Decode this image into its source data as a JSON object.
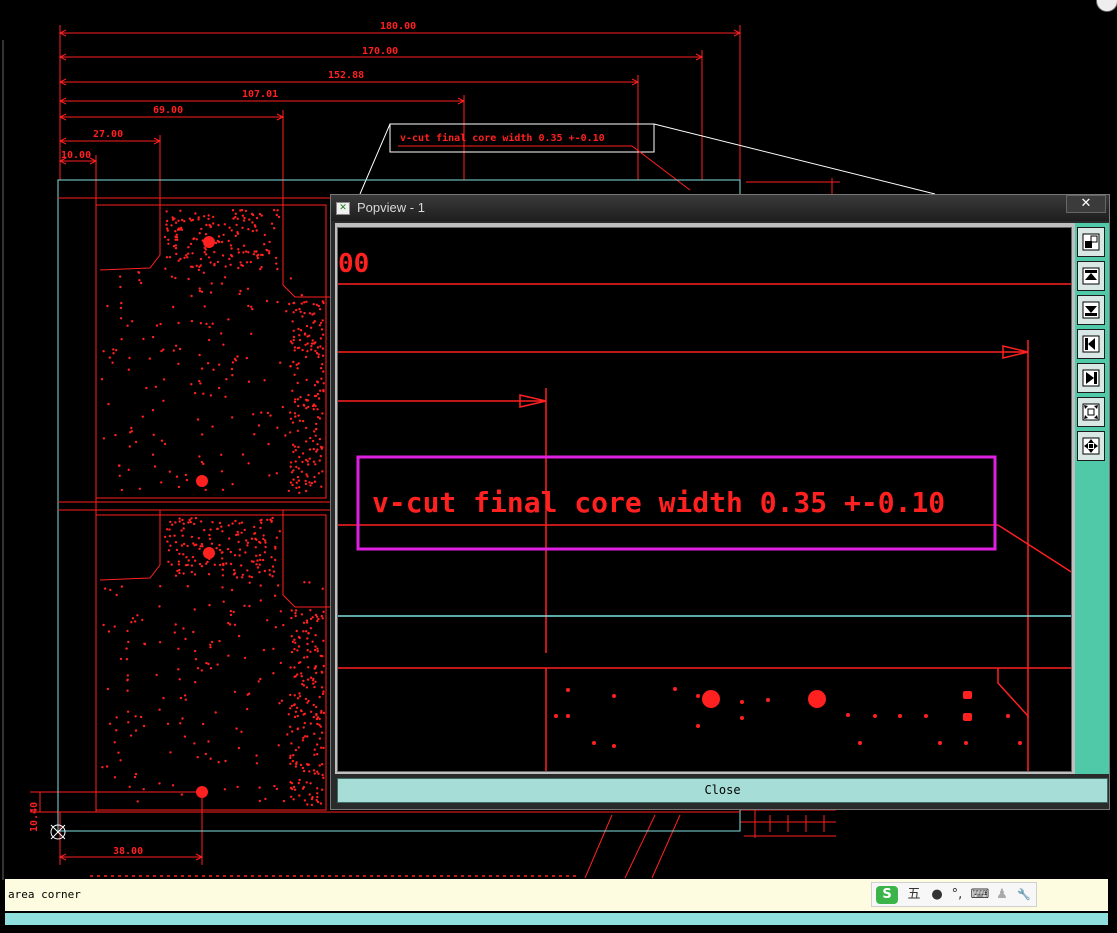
{
  "drawing": {
    "dimensions": [
      "180.00",
      "170.00",
      "152.88",
      "107.01",
      "69.00",
      "27.00",
      "10.00",
      "38.00",
      "10.40"
    ],
    "callout_text": "v-cut final core width 0.35 +-0.10"
  },
  "popview": {
    "title": "Popview - 1",
    "close_x": "✕",
    "zoom_text": "v-cut final core width 0.35 +-0.10",
    "partial_label": "00",
    "close_label": "Close",
    "toolbar": [
      "zoom-window-icon",
      "move-up-icon",
      "move-down-icon",
      "move-left-icon",
      "move-right-icon",
      "zoom-out-icon",
      "fit-view-icon"
    ]
  },
  "status": {
    "text": "area corner",
    "ime": [
      "S",
      "五",
      "●",
      "°,",
      "⌨",
      "♟",
      "🔧"
    ]
  },
  "colors": {
    "drawing_red": "#ff2020",
    "outline_cyan": "#7fe0e0",
    "highlight_magenta": "#e020e0",
    "toolbar_green": "#4fc9a8"
  }
}
